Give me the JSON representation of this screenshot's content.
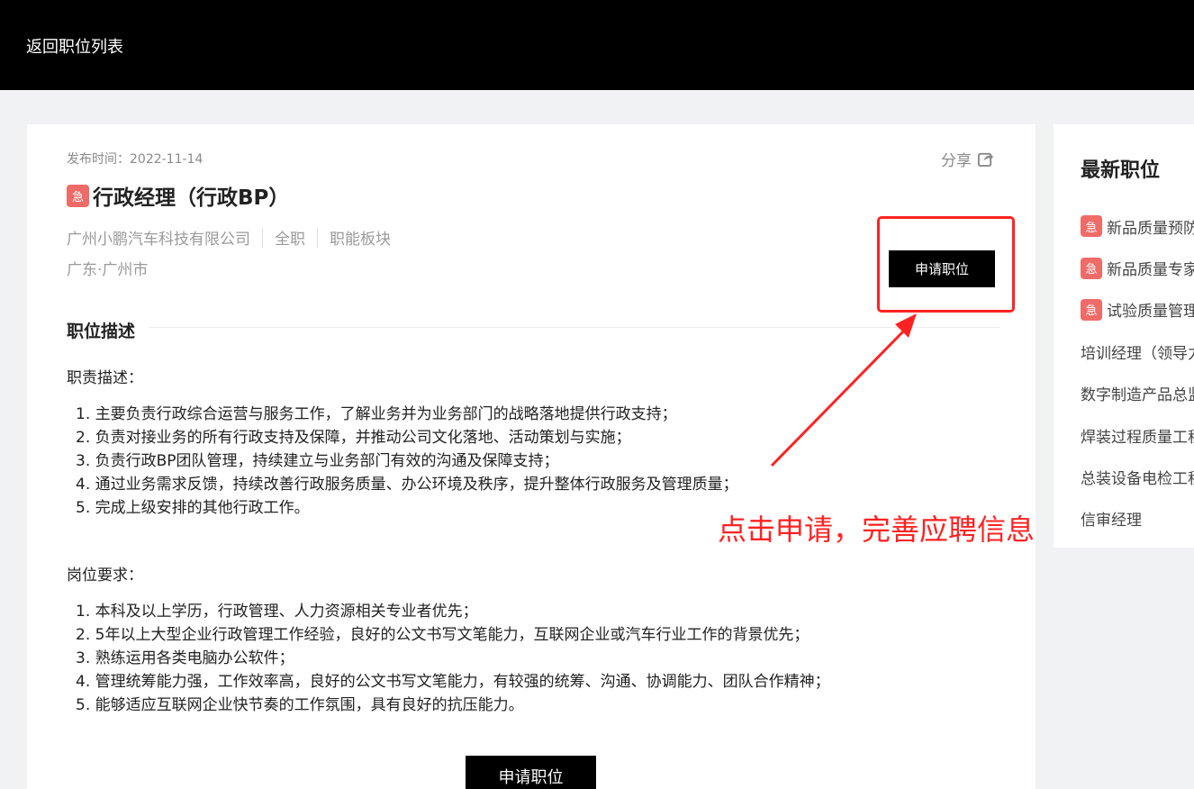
{
  "header": {
    "back_label": "返回职位列表"
  },
  "job": {
    "publish_time": "发布时间：2022-11-14",
    "share_label": "分享",
    "urgent_badge": "急",
    "title": "行政经理（行政BP）",
    "company": "广州小鹏汽车科技有限公司",
    "job_type": "全职",
    "category": "职能板块",
    "location": "广东·广州市",
    "apply_label": "申请职位"
  },
  "description": {
    "section_title": "职位描述",
    "duties_heading": "职责描述：",
    "duties": [
      "1. 主要负责行政综合运营与服务工作，了解业务并为业务部门的战略落地提供行政支持；",
      "2. 负责对接业务的所有行政支持及保障，并推动公司文化落地、活动策划与实施；",
      "3. 负责行政BP团队管理，持续建立与业务部门有效的沟通及保障支持；",
      "4. 通过业务需求反馈，持续改善行政服务质量、办公环境及秩序，提升整体行政服务及管理质量；",
      "5. 完成上级安排的其他行政工作。"
    ],
    "requirements_heading": "岗位要求：",
    "requirements": [
      "1. 本科及以上学历，行政管理、人力资源相关专业者优先；",
      "2. 5年以上大型企业行政管理工作经验，良好的公文书写文笔能力，互联网企业或汽车行业工作的背景优先；",
      "3. 熟练运用各类电脑办公软件；",
      "4. 管理统筹能力强，工作效率高，良好的公文书写文笔能力，有较强的统筹、沟通、协调能力、团队合作精神；",
      "5. 能够适应互联网企业快节奏的工作氛围，具有良好的抗压能力。"
    ],
    "apply_bottom_label": "申请职位"
  },
  "sidebar": {
    "title": "最新职位",
    "urgent_badge": "急",
    "items": [
      {
        "label": "新品质量预防",
        "urgent": true
      },
      {
        "label": "新品质量专家",
        "urgent": true
      },
      {
        "label": "试验质量管理",
        "urgent": true
      },
      {
        "label": "培训经理（领导力",
        "urgent": false
      },
      {
        "label": "数字制造产品总监",
        "urgent": false
      },
      {
        "label": "焊装过程质量工程",
        "urgent": false
      },
      {
        "label": "总装设备电检工程",
        "urgent": false
      },
      {
        "label": "信审经理",
        "urgent": false
      }
    ]
  },
  "annotation": {
    "text": "点击申请，完善应聘信息",
    "color": "#ff2222"
  },
  "colors": {
    "urgent": "#ef6b68",
    "primary_button": "#000000",
    "topbar": "#000000"
  }
}
